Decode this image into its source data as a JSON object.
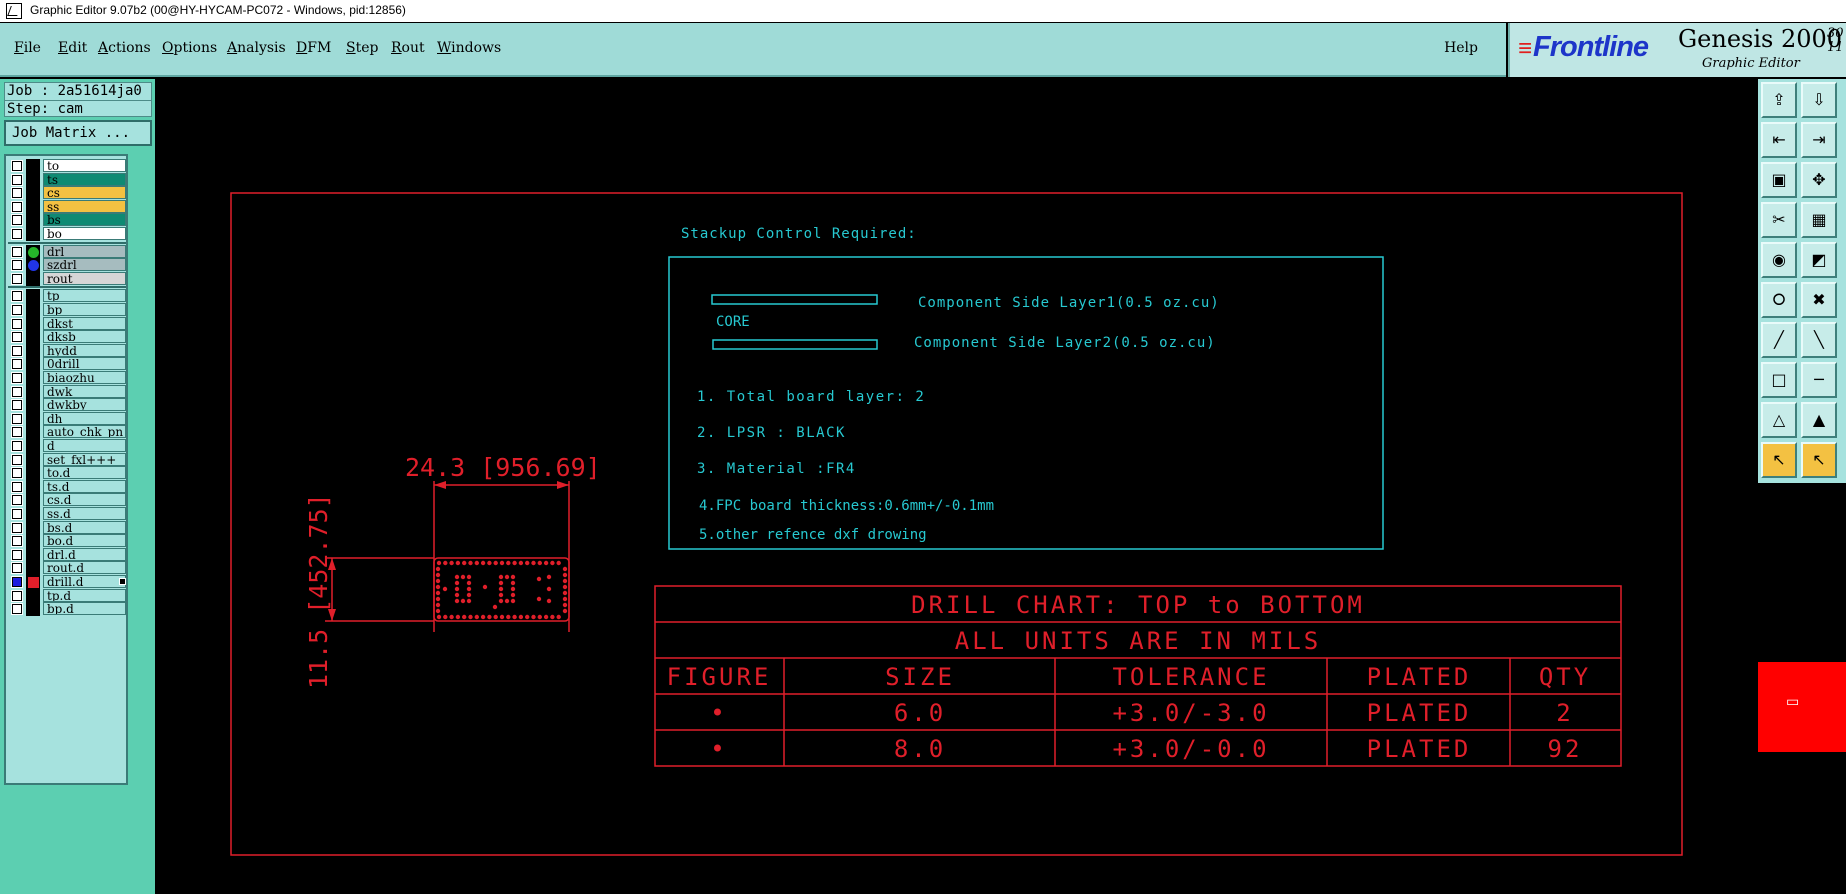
{
  "titlebar": {
    "text": "Graphic Editor 9.07b2 (00@HY-HYCAM-PC072 - Windows, pid:12856)"
  },
  "menu": {
    "items": [
      {
        "u": "F",
        "rest": "ile"
      },
      {
        "u": "E",
        "rest": "dit"
      },
      {
        "u": "A",
        "rest": "ctions"
      },
      {
        "u": "O",
        "rest": "ptions"
      },
      {
        "u": "A",
        "rest": "nalysis"
      },
      {
        "u": "D",
        "rest": "FM"
      },
      {
        "u": "S",
        "rest": "tep"
      },
      {
        "u": "R",
        "rest": "out"
      },
      {
        "u": "W",
        "rest": "indows"
      }
    ],
    "help": "Help"
  },
  "brand": {
    "logo": "Frontline",
    "product": "Genesis 2000",
    "subtitle": "Graphic Editor",
    "version_top": "30",
    "version_bottom": "11"
  },
  "job": {
    "job_label": "Job : 2a51614ja0",
    "step_label": "Step: cam",
    "matrix_button": "Job Matrix ..."
  },
  "layers": [
    {
      "name": "to",
      "color": "#ffffff",
      "checked": false
    },
    {
      "name": "ts",
      "color": "#0f8a73",
      "checked": false
    },
    {
      "name": "cs",
      "color": "#f3c142",
      "checked": false
    },
    {
      "name": "ss",
      "color": "#f3c142",
      "checked": false
    },
    {
      "name": "bs",
      "color": "#0f8a73",
      "checked": false
    },
    {
      "name": "bo",
      "color": "#ffffff",
      "checked": false
    },
    {
      "name": "drl",
      "color": "#a6bcbf",
      "checked": false,
      "dot": "#25b52a"
    },
    {
      "name": "szdrl",
      "color": "#a6bcbf",
      "checked": false,
      "dot": "#2135e8"
    },
    {
      "name": "rout",
      "color": "#d6d6d6",
      "checked": false
    },
    {
      "name": "tp",
      "color": "#a6e2de",
      "checked": false
    },
    {
      "name": "bp",
      "color": "#a6e2de",
      "checked": false
    },
    {
      "name": "dkst",
      "color": "#a6e2de",
      "checked": false
    },
    {
      "name": "dksb",
      "color": "#a6e2de",
      "checked": false
    },
    {
      "name": "hydd",
      "color": "#a6e2de",
      "checked": false
    },
    {
      "name": "0drill",
      "color": "#a6e2de",
      "checked": false
    },
    {
      "name": "biaozhu",
      "color": "#a6e2de",
      "checked": false
    },
    {
      "name": "dwk",
      "color": "#a6e2de",
      "checked": false
    },
    {
      "name": "dwkby",
      "color": "#a6e2de",
      "checked": false
    },
    {
      "name": "dh",
      "color": "#a6e2de",
      "checked": false
    },
    {
      "name": "auto_chk_pn",
      "color": "#a6e2de",
      "checked": false
    },
    {
      "name": "d",
      "color": "#a6e2de",
      "checked": false
    },
    {
      "name": "set_fxl+++",
      "color": "#a6e2de",
      "checked": false
    },
    {
      "name": "to.d",
      "color": "#a6e2de",
      "checked": false
    },
    {
      "name": "ts.d",
      "color": "#a6e2de",
      "checked": false
    },
    {
      "name": "cs.d",
      "color": "#a6e2de",
      "checked": false
    },
    {
      "name": "ss.d",
      "color": "#a6e2de",
      "checked": false
    },
    {
      "name": "bs.d",
      "color": "#a6e2de",
      "checked": false
    },
    {
      "name": "bo.d",
      "color": "#a6e2de",
      "checked": false
    },
    {
      "name": "drl.d",
      "color": "#a6e2de",
      "checked": false
    },
    {
      "name": "rout.d",
      "color": "#a6e2de",
      "checked": false
    },
    {
      "name": "drill.d",
      "color": "#a6e2de",
      "checked": true,
      "active": true
    },
    {
      "name": "tp.d",
      "color": "#a6e2de",
      "checked": false
    },
    {
      "name": "bp.d",
      "color": "#a6e2de",
      "checked": false
    }
  ],
  "drawing": {
    "stackup_title": "Stackup Control Required:",
    "layer1": "Component Side Layer1(0.5  oz.cu)",
    "core": "CORE",
    "layer2": "Component Side Layer2(0.5  oz.cu)",
    "notes": [
      "1. Total board layer:  2",
      "2. LPSR : BLACK",
      "3. Material :FR4",
      "4.FPC board thickness:0.6mm+/-0.1mm",
      "5.other refence dxf drowing"
    ],
    "dim_width": "24.3 [956.69]",
    "dim_height": "11.5 [452.75]",
    "drill_chart": {
      "title": "DRILL CHART: TOP to BOTTOM",
      "subtitle": "ALL UNITS ARE IN MILS",
      "headers": [
        "FIGURE",
        "SIZE",
        "TOLERANCE",
        "PLATED",
        "QTY"
      ],
      "rows": [
        [
          "•",
          "6.0",
          "+3.0/-3.0",
          "PLATED",
          "2"
        ],
        [
          "•",
          "8.0",
          "+3.0/-0.0",
          "PLATED",
          "92"
        ]
      ]
    }
  },
  "colors": {
    "red": "#e01f2a",
    "cyan": "#27c9d1",
    "panel": "#a6e2de",
    "accent": "#5ccfb1"
  },
  "tool_icons": [
    "zoom-home-icon",
    "zoom-out-icon",
    "pan-left-icon",
    "pan-right-icon",
    "zoom-fit-icon",
    "zoom-center-icon",
    "measure-icon",
    "grid-icon",
    "select-filter-icon",
    "resize-icon",
    "snap-node-icon",
    "delete-icon",
    "line-draw-icon",
    "line-edit-icon",
    "pad-add-icon",
    "cut-line-icon",
    "polygon-icon",
    "contour-icon",
    "pointer-icon",
    "pointer-select-icon"
  ]
}
